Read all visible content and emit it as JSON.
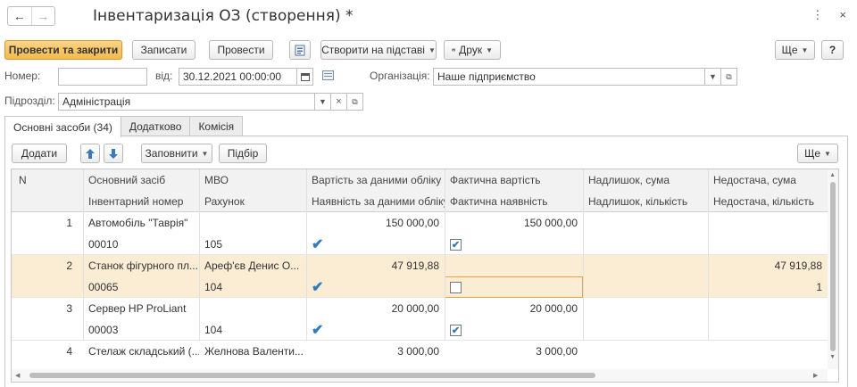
{
  "window": {
    "title": "Інвентаризація ОЗ (створення) *",
    "back_icon": "←",
    "forward_icon": "→",
    "menu_icon": "⋮",
    "close_icon": "×"
  },
  "toolbar": {
    "post_close": "Провести та закрити",
    "save": "Записати",
    "post": "Провести",
    "create_based": "Створити на підставі",
    "print": "Друк",
    "more": "Ще",
    "help": "?"
  },
  "form": {
    "number_label": "Номер:",
    "number_value": "",
    "date_label": "від:",
    "date_value": "30.12.2021 00:00:00",
    "org_label": "Організація:",
    "org_value": "Наше підприємство",
    "dept_label": "Підрозділ:",
    "dept_value": "Адміністрація"
  },
  "tabs": [
    "Основні засоби (34)",
    "Додатково",
    "Комісія"
  ],
  "table_toolbar": {
    "add": "Додати",
    "fill": "Заповнити",
    "select": "Підбір",
    "more": "Ще"
  },
  "table": {
    "headers_top": [
      "N",
      "Основний засіб",
      "МВО",
      "Вартість за даними обліку",
      "Фактична вартість",
      "Надлишок, сума",
      "Недостача, сума"
    ],
    "headers_bottom": [
      "",
      "Інвентарний номер",
      "Рахунок",
      "Наявність за даними обліку",
      "Фактична наявність",
      "Надлишок, кількість",
      "Недостача, кількість"
    ],
    "rows": [
      {
        "n": "1",
        "asset": "Автомобіль \"Таврія\"",
        "mol": "",
        "book_value": "150 000,00",
        "actual_value": "150 000,00",
        "surplus_sum": "",
        "shortage_sum": "",
        "inv_no": "00010",
        "account": "105",
        "book_present": true,
        "actual_present": true,
        "surplus_qty": "",
        "shortage_qty": ""
      },
      {
        "n": "2",
        "asset": "Станок фігурного пл...",
        "mol": "Ареф'єв Денис О...",
        "book_value": "47 919,88",
        "actual_value": "",
        "surplus_sum": "",
        "shortage_sum": "47 919,88",
        "inv_no": "00065",
        "account": "104",
        "book_present": true,
        "actual_present": false,
        "surplus_qty": "",
        "shortage_qty": "1"
      },
      {
        "n": "3",
        "asset": "Сервер HP ProLiant",
        "mol": "",
        "book_value": "20 000,00",
        "actual_value": "20 000,00",
        "surplus_sum": "",
        "shortage_sum": "",
        "inv_no": "00003",
        "account": "104",
        "book_present": true,
        "actual_present": true,
        "surplus_qty": "",
        "shortage_qty": ""
      },
      {
        "n": "4",
        "asset": "Стелаж складський (...",
        "mol": "Желнова Валенти...",
        "book_value": "3 000,00",
        "actual_value": "3 000,00",
        "surplus_sum": "",
        "shortage_sum": "",
        "inv_no": "",
        "account": "",
        "book_present": null,
        "actual_present": null,
        "surplus_qty": "",
        "shortage_qty": ""
      }
    ]
  },
  "colors": {
    "primary": "#f3b94d",
    "selected_row": "#fbecd4",
    "check": "#2e7bbd"
  }
}
